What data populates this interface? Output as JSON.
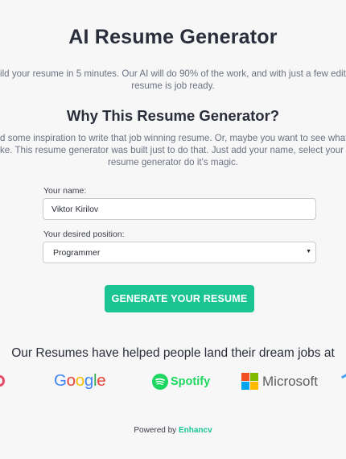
{
  "page": {
    "title": "AI Resume Generator",
    "intro_lines": [
      "ild your resume in 5 minutes. Our AI will do 90% of the work, and with just a few edits,",
      "resume is job ready."
    ]
  },
  "why": {
    "title": "Why This Resume Generator?",
    "lines": [
      "d some inspiration to write that job winning resume. Or, maybe you want to see what",
      "ke. This resume generator was built just to do that. Just add your name, select your i",
      "resume generator do it's magic."
    ]
  },
  "form": {
    "name_label": "Your name:",
    "name_value": "Viktor Kirilov",
    "position_label": "Your desired position:",
    "position_value": "Programmer",
    "generate_label": "GENERATE YOUR RESUME"
  },
  "logos_section": {
    "heading": "Our Resumes have helped people land their dream jobs at",
    "logos": {
      "google": [
        "G",
        "o",
        "o",
        "g",
        "l",
        "e"
      ],
      "spotify": "Spotify",
      "microsoft": "Microsoft"
    },
    "colors": {
      "google": [
        "#4285F4",
        "#EA4335",
        "#FBBC05",
        "#4285F4",
        "#34A853",
        "#EA4335"
      ],
      "spotify": "#1ed760",
      "microsoft_tiles": [
        "#f25022",
        "#7fba00",
        "#00a4ef",
        "#ffb900"
      ]
    }
  },
  "footer": {
    "powered_prefix": "Powered by",
    "brand": "Enhancv"
  },
  "colors": {
    "accent": "#1bc593",
    "background": "#f7f7f8"
  }
}
